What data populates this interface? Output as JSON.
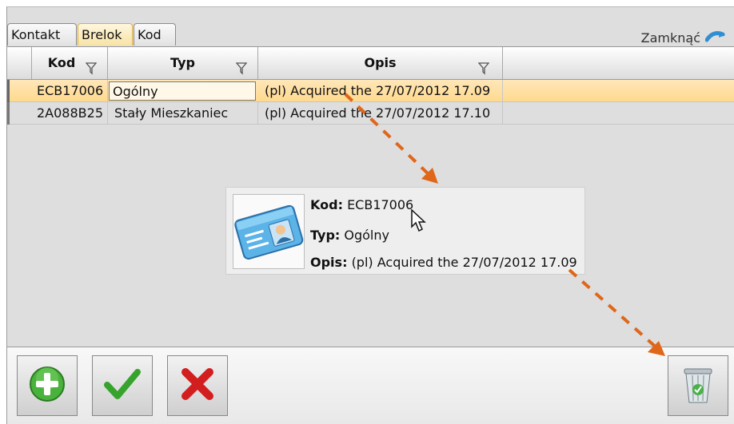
{
  "tabs": [
    {
      "label": "Kontakt",
      "active": false
    },
    {
      "label": "Brelok",
      "active": true
    },
    {
      "label": "Kod",
      "active": false
    }
  ],
  "close_label": "Zamknąć",
  "columns": {
    "kod": "Kod",
    "typ": "Typ",
    "opis": "Opis"
  },
  "rows": [
    {
      "kod": "ECB17006",
      "typ": "Ogólny",
      "opis": "(pl) Acquired the 27/07/2012 17.09",
      "selected": true
    },
    {
      "kod": "2A088B25",
      "typ": "Stały Mieszkaniec",
      "opis": "(pl) Acquired the 27/07/2012 17.10",
      "selected": false
    }
  ],
  "tooltip": {
    "kod_label": "Kod:",
    "kod_value": "ECB17006",
    "typ_label": "Typ:",
    "typ_value": "Ogólny",
    "opis_label": "Opis:",
    "opis_value": "(pl) Acquired the 27/07/2012 17.09"
  },
  "toolbar": {
    "add_icon": "plus-circle-icon",
    "confirm_icon": "check-icon",
    "cancel_icon": "x-icon",
    "delete_icon": "trash-icon"
  },
  "colors": {
    "accent": "#f7d98c",
    "arrow": "#e0661a",
    "add_green": "#3a9b2f",
    "cancel_red": "#d21e1e"
  }
}
